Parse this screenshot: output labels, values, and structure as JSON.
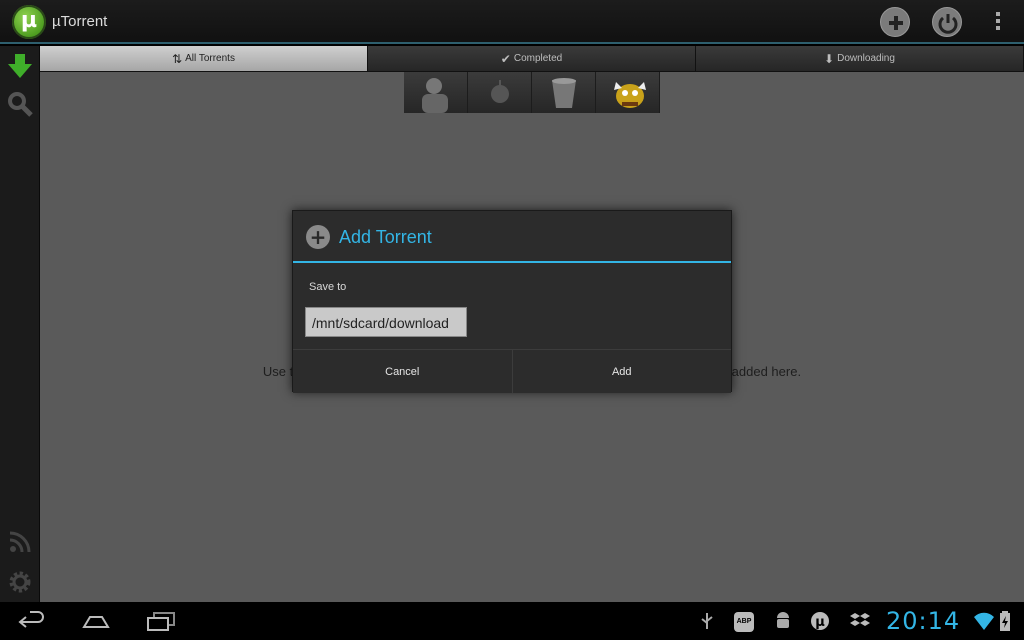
{
  "app": {
    "title": "µTorrent",
    "logo_letter": "µ"
  },
  "actionbar": {
    "icons": [
      "add-icon",
      "power-icon",
      "overflow-icon"
    ]
  },
  "tabs": [
    {
      "label": "All Torrents",
      "icon": "sort-icon",
      "active": true
    },
    {
      "label": "Completed",
      "icon": "check-icon",
      "active": false
    },
    {
      "label": "Downloading",
      "icon": "download-arrow-icon",
      "active": false
    }
  ],
  "leftnav": [
    "download-icon",
    "search-icon",
    "rss-icon",
    "settings-icon"
  ],
  "content": {
    "empty_message": "Use the search icon on the left to find torrents. Torrents that you download will be added here."
  },
  "dialog": {
    "title": "Add Torrent",
    "save_to_label": "Save to",
    "save_path": "/mnt/sdcard/download",
    "cancel_label": "Cancel",
    "add_label": "Add"
  },
  "statusbar": {
    "clock": "20:14",
    "adblock_label": "ABP",
    "icons": [
      "back-icon",
      "home-icon",
      "recents-icon",
      "usb-icon",
      "adblock-icon",
      "android-debug-icon",
      "utorrent-icon",
      "dropbox-icon",
      "wifi-icon",
      "battery-icon"
    ]
  },
  "colors": {
    "accent": "#33b5e5",
    "background": "#5a5a5a",
    "dialog": "#2c2c2c"
  }
}
